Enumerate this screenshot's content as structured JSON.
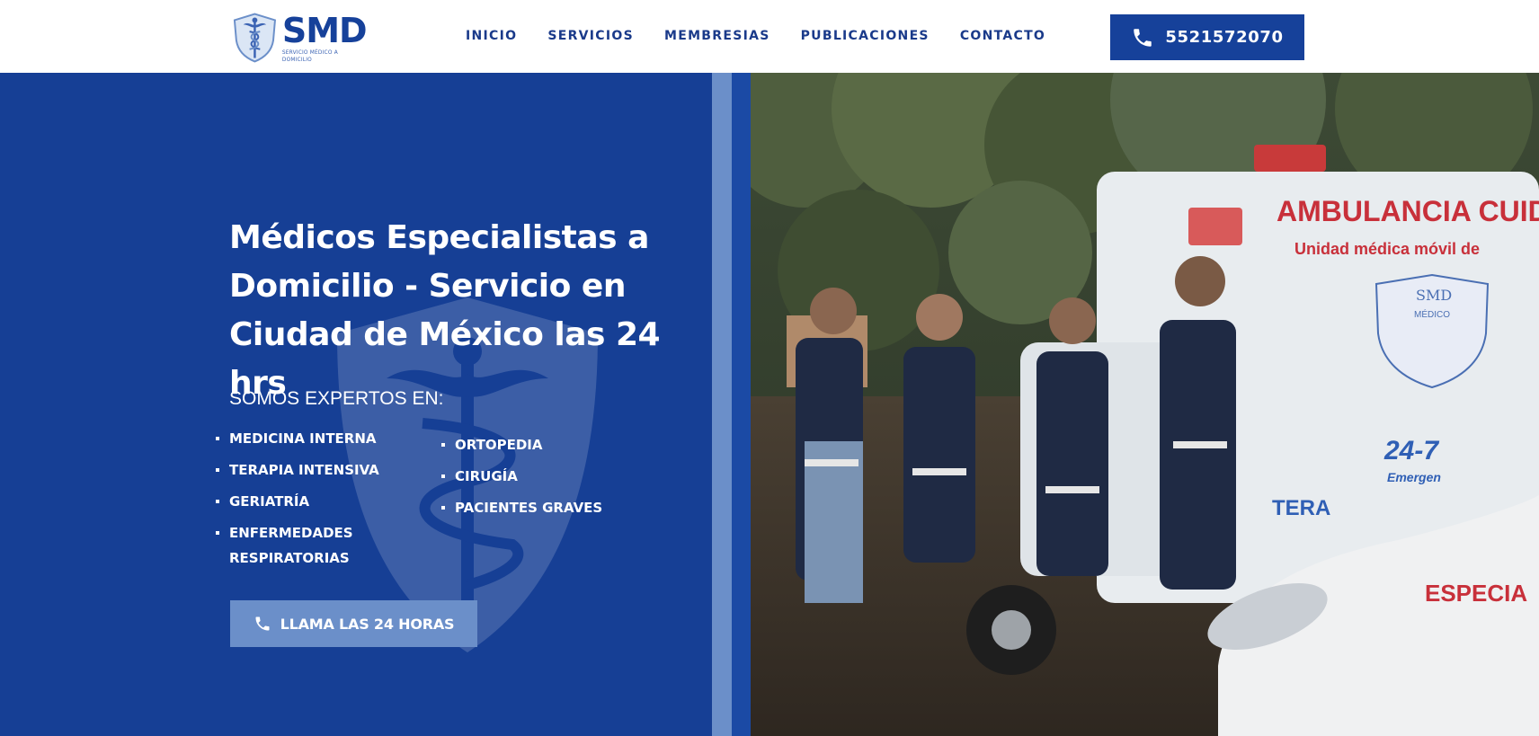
{
  "header": {
    "logo": {
      "wordmark": "SMD",
      "subtitle": "SERVICIO MÉDICO A DOMICILIO",
      "icon": "medical-shield-caduceus"
    },
    "nav": [
      {
        "label": "INICIO"
      },
      {
        "label": "SERVICIOS"
      },
      {
        "label": "MEMBRESIAS"
      },
      {
        "label": "PUBLICACIONES"
      },
      {
        "label": "CONTACTO"
      }
    ],
    "phone_button": {
      "icon": "phone-icon",
      "number": "5521572070"
    }
  },
  "hero": {
    "title": "Médicos Especialistas a Domicilio - Servicio en Ciudad de México las 24 hrs",
    "experts_heading": "SOMOS EXPERTOS EN:",
    "specialties_col1": [
      "MEDICINA INTERNA",
      "TERAPIA INTENSIVA",
      "GERIATRÍA",
      "ENFERMEDADES RESPIRATORIAS"
    ],
    "specialties_col2": [
      "ORTOPEDIA",
      "CIRUGÍA",
      "PACIENTES GRAVES"
    ],
    "cta": {
      "icon": "phone-icon",
      "label": "LLAMA LAS 24 HORAS"
    }
  },
  "photo": {
    "ambulance_title": "AMBULANCIA CUIDADO",
    "ambulance_subtitle": "Unidad médica móvil de",
    "emblem_text": "SMD",
    "emblem_sub": "MÉDICO",
    "badge": "24-7",
    "badge_text": "Emergen",
    "side_text": "TERA",
    "car_text": "ESPECIA"
  },
  "colors": {
    "brand_blue": "#163f95",
    "light_blue": "#6b8fc9",
    "nav_text": "#1a3a8a"
  }
}
